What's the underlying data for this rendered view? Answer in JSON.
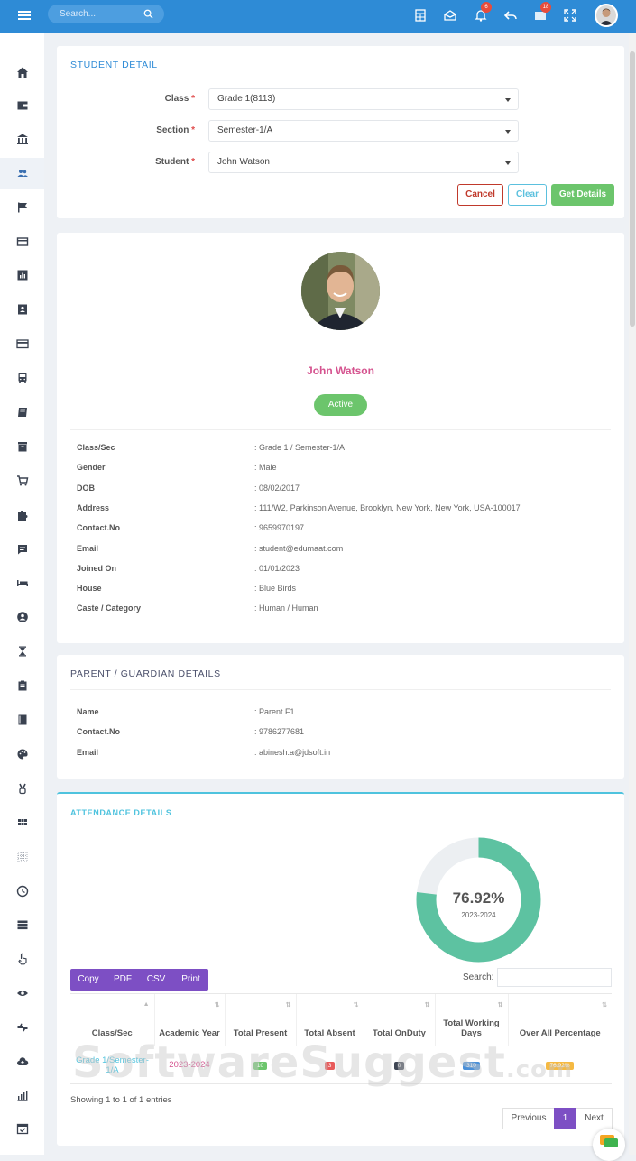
{
  "topbar": {
    "search_placeholder": "Search...",
    "notif_badge": "6",
    "mail_badge": "18"
  },
  "student_detail": {
    "title": "STUDENT DETAIL",
    "class_label": "Class",
    "class_value": "Grade 1(8113)",
    "section_label": "Section",
    "section_value": "Semester-1/A",
    "student_label": "Student",
    "student_value": "John Watson",
    "required": "*",
    "cancel": "Cancel",
    "clear": "Clear",
    "get_details": "Get Details"
  },
  "profile": {
    "name": "John Watson",
    "status": "Active",
    "rows": [
      {
        "k": "Class/Sec",
        "v": ": Grade 1 / Semester-1/A"
      },
      {
        "k": "Gender",
        "v": ": Male"
      },
      {
        "k": "DOB",
        "v": ": 08/02/2017"
      },
      {
        "k": "Address",
        "v": ": 111/W2, Parkinson Avenue, Brooklyn, New York, New York, USA-100017"
      },
      {
        "k": "Contact.No",
        "v": ": 9659970197"
      },
      {
        "k": "Email",
        "v": ": student@edumaat.com"
      },
      {
        "k": "Joined On",
        "v": ": 01/01/2023"
      },
      {
        "k": "House",
        "v": ": Blue Birds"
      },
      {
        "k": "Caste / Category",
        "v": ": Human / Human"
      }
    ]
  },
  "parent": {
    "title": "PARENT / GUARDIAN DETAILS",
    "rows": [
      {
        "k": "Name",
        "v": ": Parent F1"
      },
      {
        "k": "Contact.No",
        "v": ": 9786277681"
      },
      {
        "k": "Email",
        "v": ": abinesh.a@jdsoft.in"
      }
    ]
  },
  "attendance": {
    "title": "ATTENDANCE DETAILS",
    "donut_percent": 76.92,
    "donut_label": "76.92%",
    "donut_sub": "2023-2024",
    "colors": {
      "filled": "#5dc2a1",
      "empty": "#eceff2"
    },
    "buttons": [
      "Copy",
      "PDF",
      "CSV",
      "Print"
    ],
    "search_label": "Search:",
    "columns": [
      "Class/Sec",
      "Academic Year",
      "Total Present",
      "Total Absent",
      "Total OnDuty",
      "Total Working Days",
      "Over All Percentage"
    ],
    "row": {
      "class_sec": "Grade 1/Semester-1/A",
      "year": "2023-2024",
      "present": "10",
      "absent": "3",
      "onduty": "0",
      "working": "310",
      "percentage": "76.92%"
    },
    "showing": "Showing 1 to 1 of 1 entries",
    "prev": "Previous",
    "page": "1",
    "next": "Next"
  },
  "watermark": {
    "main": "SoftwareSuggest",
    "suffix": ".com"
  }
}
